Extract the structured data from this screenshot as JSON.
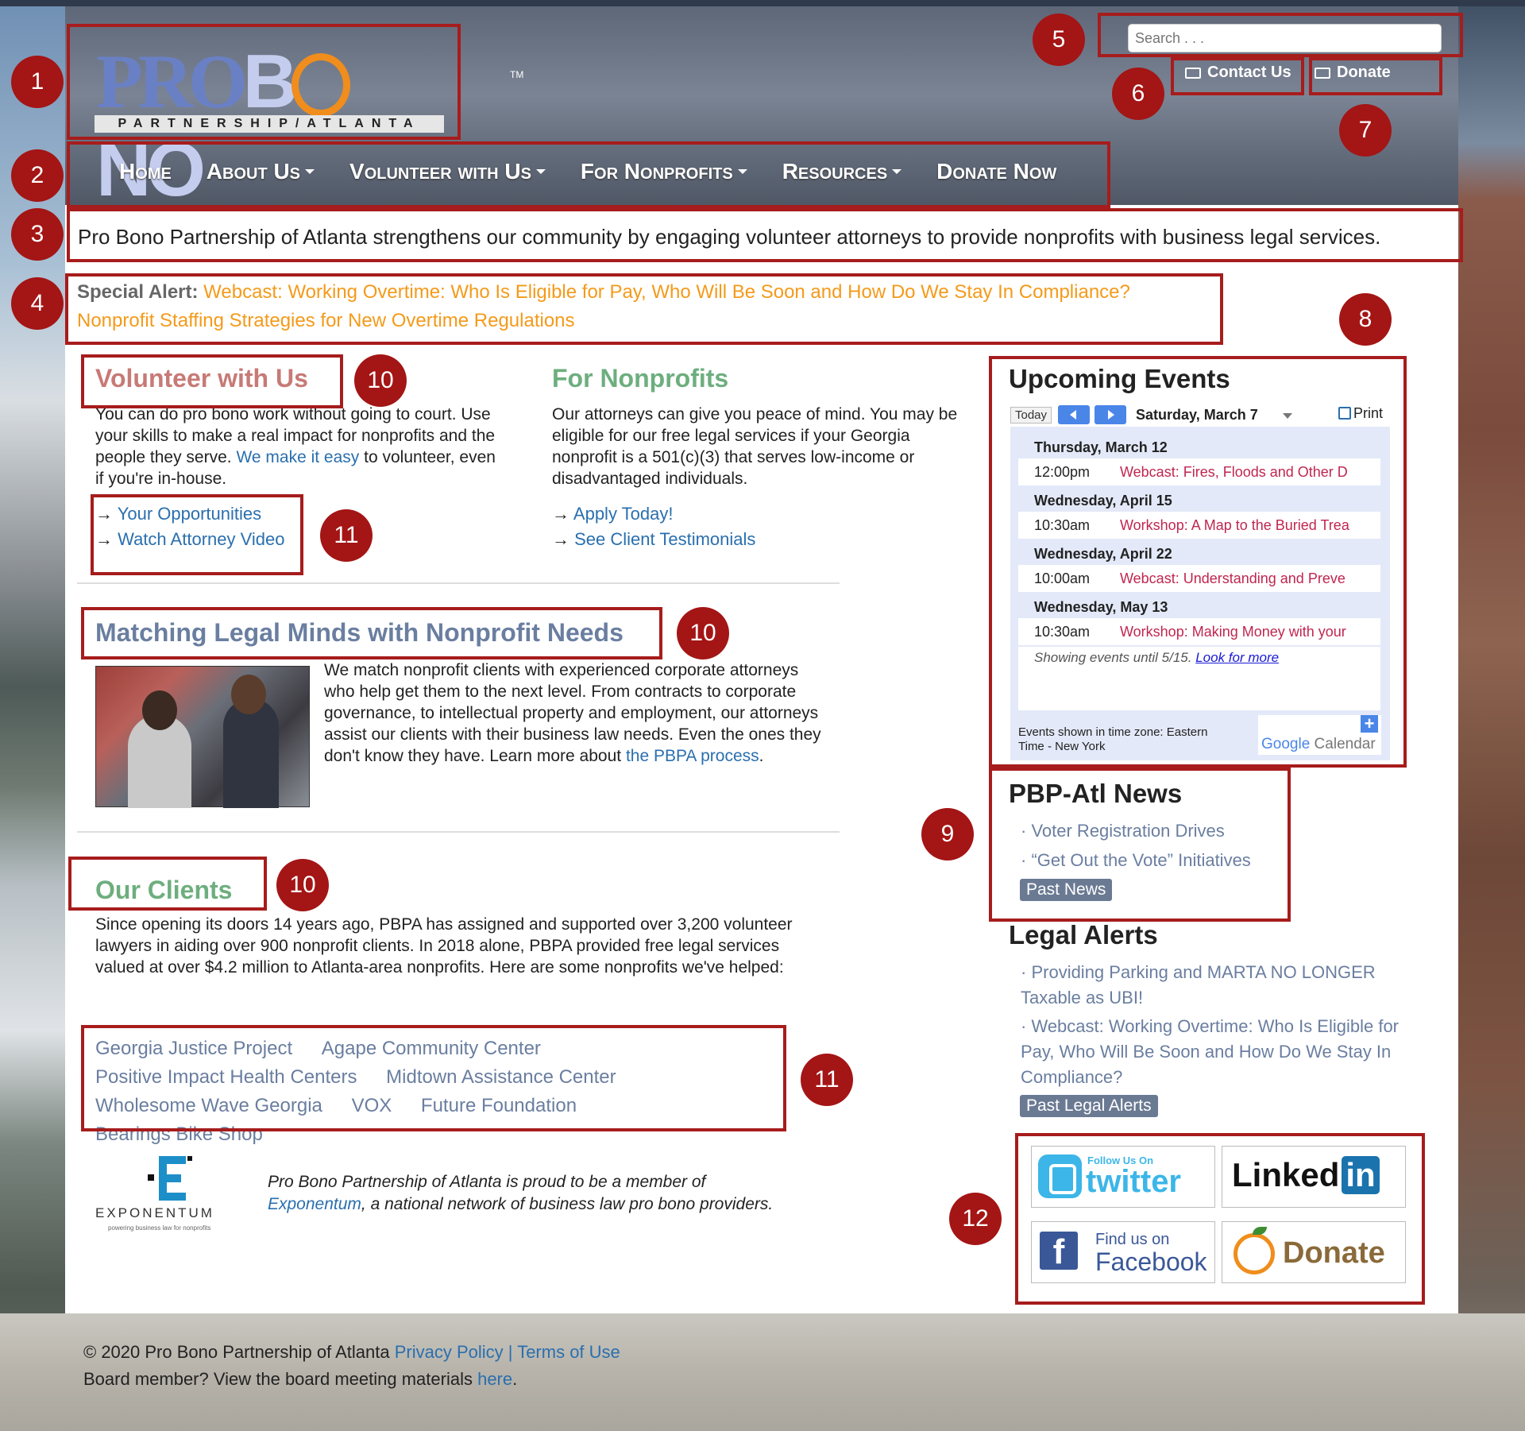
{
  "header": {
    "logo": {
      "word_pro": "PRO",
      "word_b": "B",
      "word_no": "NO",
      "tagline": "PARTNERSHIP/ATLANTA",
      "tm": "TM"
    },
    "search": {
      "placeholder": "Search . . ."
    },
    "contact_label": "Contact Us",
    "donate_label": "Donate"
  },
  "nav": {
    "items": [
      {
        "label": "Home",
        "dropdown": false
      },
      {
        "label": "About Us",
        "dropdown": true
      },
      {
        "label": "Volunteer with Us",
        "dropdown": true
      },
      {
        "label": "For Nonprofits",
        "dropdown": true
      },
      {
        "label": "Resources",
        "dropdown": true
      },
      {
        "label": "Donate Now",
        "dropdown": false
      }
    ]
  },
  "tagline": "Pro Bono Partnership of Atlanta strengthens our community by engaging volunteer attorneys to provide nonprofits with business legal services.",
  "alert": {
    "label": "Special Alert:",
    "link1": "Webcast: Working Overtime: Who Is Eligible for Pay, Who Will Be Soon and How Do We Stay In Compliance?",
    "link2": "Nonprofit Staffing Strategies for New Overtime Regulations"
  },
  "volunteer": {
    "title": "Volunteer with Us",
    "text_a": "You can do pro bono work without going to court. Use your skills to make a real impact for nonprofits and the people they serve.",
    "link": "We make it easy",
    "text_b": "to volunteer, even if you're in-house.",
    "links": [
      "Your Opportunities",
      "Watch Attorney Video"
    ]
  },
  "nonprofits": {
    "title": "For Nonprofits",
    "text": "Our attorneys can give you peace of mind. You may be eligible for our free legal services if your Georgia nonprofit is a 501(c)(3) that serves low-income or disadvantaged individuals.",
    "links": [
      "Apply Today!",
      "See Client Testimonials"
    ]
  },
  "arrow": "→",
  "matching": {
    "title": "Matching Legal Minds with Nonprofit Needs",
    "text": "We match nonprofit clients with experienced corporate attorneys who help get them to the next level. From contracts to corporate governance, to intellectual property and employment, our attorneys assist our clients with their business law needs. Even the ones they don't know they have. Learn more about",
    "link": "the PBPA process",
    "end": "."
  },
  "clients": {
    "title": "Our Clients",
    "text": "Since opening its doors 14 years ago, PBPA has assigned and supported over 3,200 volunteer lawyers in aiding over 900 nonprofit clients. In 2018 alone, PBPA provided free legal services valued at over $4.2 million to Atlanta-area nonprofits. Here are some nonprofits we've helped:",
    "list": [
      "Georgia Justice Project",
      "Agape Community Center",
      "Positive Impact Health Centers",
      "Midtown Assistance Center",
      "Wholesome Wave Georgia",
      "VOX",
      "Future Foundation",
      "Bearings Bike Shop"
    ]
  },
  "exponentum": {
    "name": "EXPONENTUM",
    "tag": "powering business law for nonprofits",
    "text_a": "Pro Bono Partnership of Atlanta is proud to be a member of",
    "link": "Exponentum",
    "text_b": ", a national network of business law pro bono providers."
  },
  "calendar": {
    "title": "Upcoming Events",
    "today": "Today",
    "current_date": "Saturday, March 7",
    "print": "Print",
    "days": [
      {
        "day": "Thursday, March 12",
        "time": "12:00pm",
        "event": "Webcast: Fires, Floods and Other D"
      },
      {
        "day": "Wednesday, April 15",
        "time": "10:30am",
        "event": "Workshop: A Map to the Buried Trea"
      },
      {
        "day": "Wednesday, April 22",
        "time": "10:00am",
        "event": "Webcast: Understanding and Preve"
      },
      {
        "day": "Wednesday, May 13",
        "time": "10:30am",
        "event": "Workshop: Making Money with your"
      }
    ],
    "showing": "Showing events until 5/15.",
    "look_more": "Look for more",
    "timezone": "Events shown in time zone: Eastern Time - New York",
    "gcal_google": "Google",
    "gcal_calendar": " Calendar",
    "gcal_plus": "+",
    "accent": "#4a86e8"
  },
  "news": {
    "title": "PBP-Atl News",
    "bullet": "·",
    "items": [
      "Voter Registration Drives",
      "“Get Out the Vote” Initiatives"
    ],
    "past": "Past News"
  },
  "legal": {
    "title": "Legal Alerts",
    "items": [
      "Providing Parking and MARTA NO LONGER Taxable as UBI!",
      "Webcast: Working Overtime: Who Is Eligible for Pay, Who Will Be Soon and How Do We Stay In Compliance?"
    ],
    "past": "Past Legal Alerts"
  },
  "social": {
    "twitter_follow": "Follow Us On",
    "twitter": "twitter",
    "linkedin": "Linked",
    "linkedin_in": "in",
    "fb_find": "Find us on",
    "fb_name": "Facebook",
    "fb_f": "f",
    "donate": "Donate"
  },
  "footer": {
    "copyright": "© 2020 Pro Bono Partnership of Atlanta",
    "privacy": "Privacy Policy",
    "sep": "|",
    "terms": "Terms of Use",
    "board_text": "Board member? View the board meeting materials",
    "board_link": "here",
    "board_end": "."
  },
  "annotations": [
    "1",
    "2",
    "3",
    "4",
    "5",
    "6",
    "7",
    "8",
    "9",
    "10",
    "10",
    "10",
    "11",
    "11",
    "12"
  ],
  "colors": {
    "annotation": "#a41515",
    "link": "#2a6fae",
    "alert": "#f49a1a",
    "volunteer_title": "#c77a76",
    "nonprofit_title": "#6dae7e",
    "matching_title": "#6a7ea0",
    "event_link": "#c0264f"
  }
}
